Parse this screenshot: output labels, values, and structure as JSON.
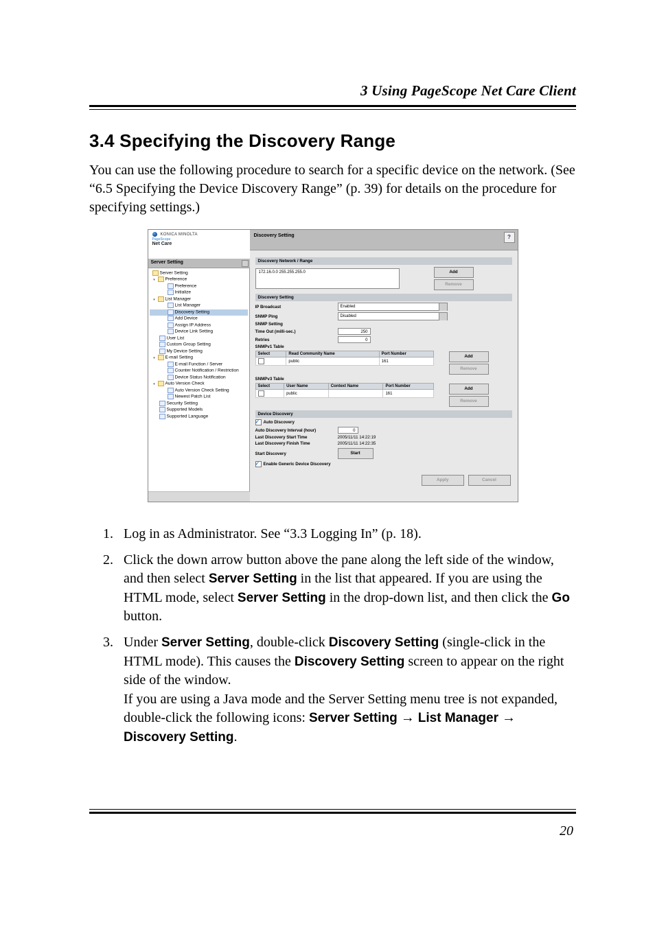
{
  "header": {
    "chapter_title": "3  Using PageScope Net Care Client"
  },
  "section": {
    "number_name": "3.4  Specifying the Discovery Range"
  },
  "intro": {
    "text": "You can use the following procedure to search for a specific device on the network. (See “6.5 Specifying the Device Discovery Range” (p. 39) for details on the procedure for specifying settings.)"
  },
  "screenshot": {
    "vendor": "KONICA MINOLTA",
    "product_prefix": "PageScope",
    "product": "Net Care",
    "dropdown": "Server Setting",
    "tree": {
      "root": "Server Setting",
      "preference": "Preference",
      "pref_preference": "Preference",
      "pref_initialize": "Initialize",
      "list_manager": "List Manager",
      "lm_list_manager": "List Manager",
      "lm_discovery_setting_sel": "Discovery Setting",
      "lm_add_device": "Add Device",
      "lm_assign_ip": "Assign IP Address",
      "lm_device_link": "Device Link Setting",
      "user_list": "User List",
      "custom_group": "Custom Group Setting",
      "my_device": "My Device Setting",
      "email_setting": "E-mail Setting",
      "email_func": "E-mail Function / Server",
      "email_counter": "Counter Notification / Restriction",
      "email_status": "Device Status Notification",
      "auto_ver": "Auto Version Check",
      "auto_ver_setting": "Auto Version Check Setting",
      "auto_ver_patch": "Newest Patch List",
      "security": "Security Setting",
      "models": "Supported Models",
      "lang": "Supported Language"
    },
    "main": {
      "title": "Discovery Setting",
      "help": "?",
      "g_network_range": "Discovery Network / Range",
      "range_item": "172.16.0.0 255.255.255.0",
      "btn_add": "Add",
      "btn_remove": "Remove",
      "g_discovery_setting": "Discovery Setting",
      "ip_broadcast": "IP Broadcast",
      "ip_broadcast_val": "Enabled",
      "snmp_ping": "SNMP Ping",
      "snmp_ping_val": "Disabled",
      "snmp_setting": "SNMP Setting",
      "timeout": "Time Out (milli-sec.)",
      "timeout_val": "250",
      "retries": "Retries",
      "retries_val": "0",
      "snmpv1_table": "SNMPv1 Table",
      "snmpv1_h_sel": "Select",
      "snmpv1_h_name": "Read Community Name",
      "snmpv1_h_port": "Port Number",
      "snmpv1_name": "public",
      "snmpv1_port": "161",
      "snmpv3_table": "SNMPv3 Table",
      "snmpv3_h_sel": "Select",
      "snmpv3_h_user": "User Name",
      "snmpv3_h_ctx": "Context Name",
      "snmpv3_h_port": "Port Number",
      "snmpv3_user": "public",
      "snmpv3_port": "161",
      "g_device_discovery": "Device Discovery",
      "auto_disc": "Auto Discovery",
      "auto_interval": "Auto Discovery Interval (hour)",
      "auto_interval_val": "0",
      "last_start": "Last Discovery Start Time",
      "last_start_val": "2005/11/11 14:22:19",
      "last_finish": "Last Discovery Finish Time",
      "last_finish_val": "2005/11/11 14:22:35",
      "start_discovery": "Start Discovery",
      "btn_start": "Start",
      "enable_generic": "Enable Generic Device Discovery",
      "btn_apply": "Apply",
      "btn_cancel": "Cancel"
    }
  },
  "steps": {
    "s1": "Log in as Administrator. See “3.3 Logging In” (p. 18).",
    "s2_a": "Click the down arrow button above the pane along the left side of the window, and then select ",
    "s2_b": "Server Setting",
    "s2_c": " in the list that appeared. If you are using the HTML mode, select ",
    "s2_d": "Server Setting",
    "s2_e": " in the drop-down list, and then click the ",
    "s2_f": "Go",
    "s2_g": " button.",
    "s3_a": "Under ",
    "s3_b": "Server Setting",
    "s3_c": ", double-click ",
    "s3_d": "Discovery Setting",
    "s3_e": " (single-click in the HTML mode). This causes the ",
    "s3_f": "Discovery Setting",
    "s3_g": " screen to appear on the right side of the window.",
    "s3_h": "If you are using a Java mode and the Server Setting menu tree is not expanded, double-click the following icons: ",
    "s3_i": "Server Setting",
    "s3_j": " → ",
    "s3_k": "List Manager",
    "s3_l": " → ",
    "s3_m": "Discovery Setting",
    "s3_n": "."
  },
  "footer": {
    "page": "20"
  }
}
